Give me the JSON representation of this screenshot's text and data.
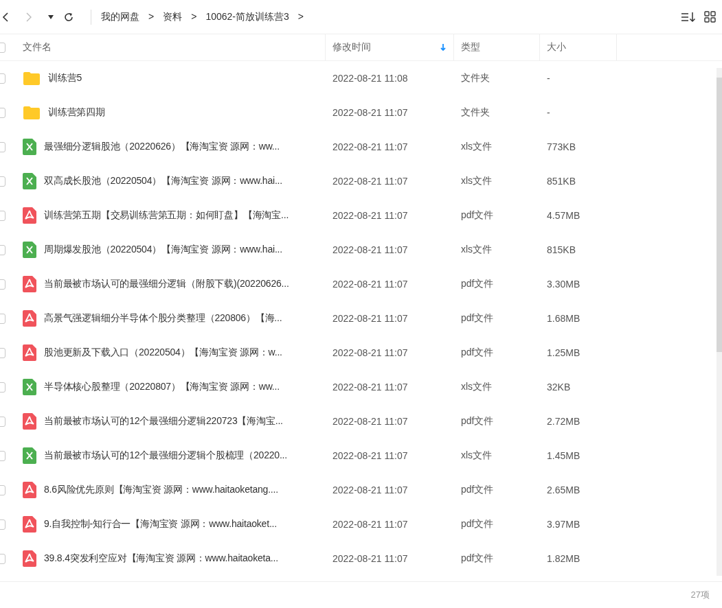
{
  "breadcrumb": [
    "我的网盘",
    ">",
    "资料",
    ">",
    "10062-简放训练营3",
    ">"
  ],
  "table": {
    "columns": [
      {
        "label": "文件名",
        "sorted": false
      },
      {
        "label": "修改时间",
        "sorted": true
      },
      {
        "label": "类型",
        "sorted": false
      },
      {
        "label": "大小",
        "sorted": false
      }
    ],
    "select_all": {
      "checked": false
    },
    "rows": [
      {
        "kind": "folder",
        "checked": false,
        "name": "训练营5",
        "modified": "2022-08-21 11:08",
        "type": "文件夹",
        "size": "-"
      },
      {
        "kind": "folder",
        "checked": false,
        "name": "训练营第四期",
        "modified": "2022-08-21 11:07",
        "type": "文件夹",
        "size": "-"
      },
      {
        "kind": "xls",
        "checked": false,
        "name": "最强细分逻辑股池（20220626）【海淘宝资 源网：ww...",
        "modified": "2022-08-21 11:07",
        "type": "xls文件",
        "size": "773KB"
      },
      {
        "kind": "xls",
        "checked": false,
        "name": "双高成长股池（20220504）【海淘宝资 源网：www.hai...",
        "modified": "2022-08-21 11:07",
        "type": "xls文件",
        "size": "851KB"
      },
      {
        "kind": "pdf",
        "checked": false,
        "name": "训练营第五期【交易训练营第五期：如何盯盘】【海淘宝...",
        "modified": "2022-08-21 11:07",
        "type": "pdf文件",
        "size": "4.57MB"
      },
      {
        "kind": "xls",
        "checked": false,
        "name": "周期爆发股池（20220504）【海淘宝资 源网：www.hai...",
        "modified": "2022-08-21 11:07",
        "type": "xls文件",
        "size": "815KB"
      },
      {
        "kind": "pdf",
        "checked": false,
        "name": "当前最被市场认可的最强细分逻辑（附股下载)(20220626...",
        "modified": "2022-08-21 11:07",
        "type": "pdf文件",
        "size": "3.30MB"
      },
      {
        "kind": "pdf",
        "checked": false,
        "name": "高景气强逻辑细分半导体个股分类整理（220806）【海...",
        "modified": "2022-08-21 11:07",
        "type": "pdf文件",
        "size": "1.68MB"
      },
      {
        "kind": "pdf",
        "checked": false,
        "name": "股池更新及下载入口（20220504）【海淘宝资 源网：w...",
        "modified": "2022-08-21 11:07",
        "type": "pdf文件",
        "size": "1.25MB"
      },
      {
        "kind": "xls",
        "checked": false,
        "name": "半导体核心股整理（20220807）【海淘宝资 源网：ww...",
        "modified": "2022-08-21 11:07",
        "type": "xls文件",
        "size": "32KB"
      },
      {
        "kind": "pdf",
        "checked": false,
        "name": "当前最被市场认可的12个最强细分逻辑220723【海淘宝...",
        "modified": "2022-08-21 11:07",
        "type": "pdf文件",
        "size": "2.72MB"
      },
      {
        "kind": "xls",
        "checked": false,
        "name": "当前最被市场认可的12个最强细分逻辑个股梳理（20220...",
        "modified": "2022-08-21 11:07",
        "type": "xls文件",
        "size": "1.45MB"
      },
      {
        "kind": "pdf",
        "checked": false,
        "name": "8.6风险优先原则【海淘宝资 源网：www.haitaoketang....",
        "modified": "2022-08-21 11:07",
        "type": "pdf文件",
        "size": "2.65MB"
      },
      {
        "kind": "pdf",
        "checked": false,
        "name": "9.自我控制-知行合一【海淘宝资 源网：www.haitaoket...",
        "modified": "2022-08-21 11:07",
        "type": "pdf文件",
        "size": "3.97MB"
      },
      {
        "kind": "pdf",
        "checked": false,
        "name": "39.8.4突发利空应对【海淘宝资 源网：www.haitaoketa...",
        "modified": "2022-08-21 11:07",
        "type": "pdf文件",
        "size": "1.82MB"
      }
    ]
  },
  "status_bar": {
    "count": "27项"
  }
}
